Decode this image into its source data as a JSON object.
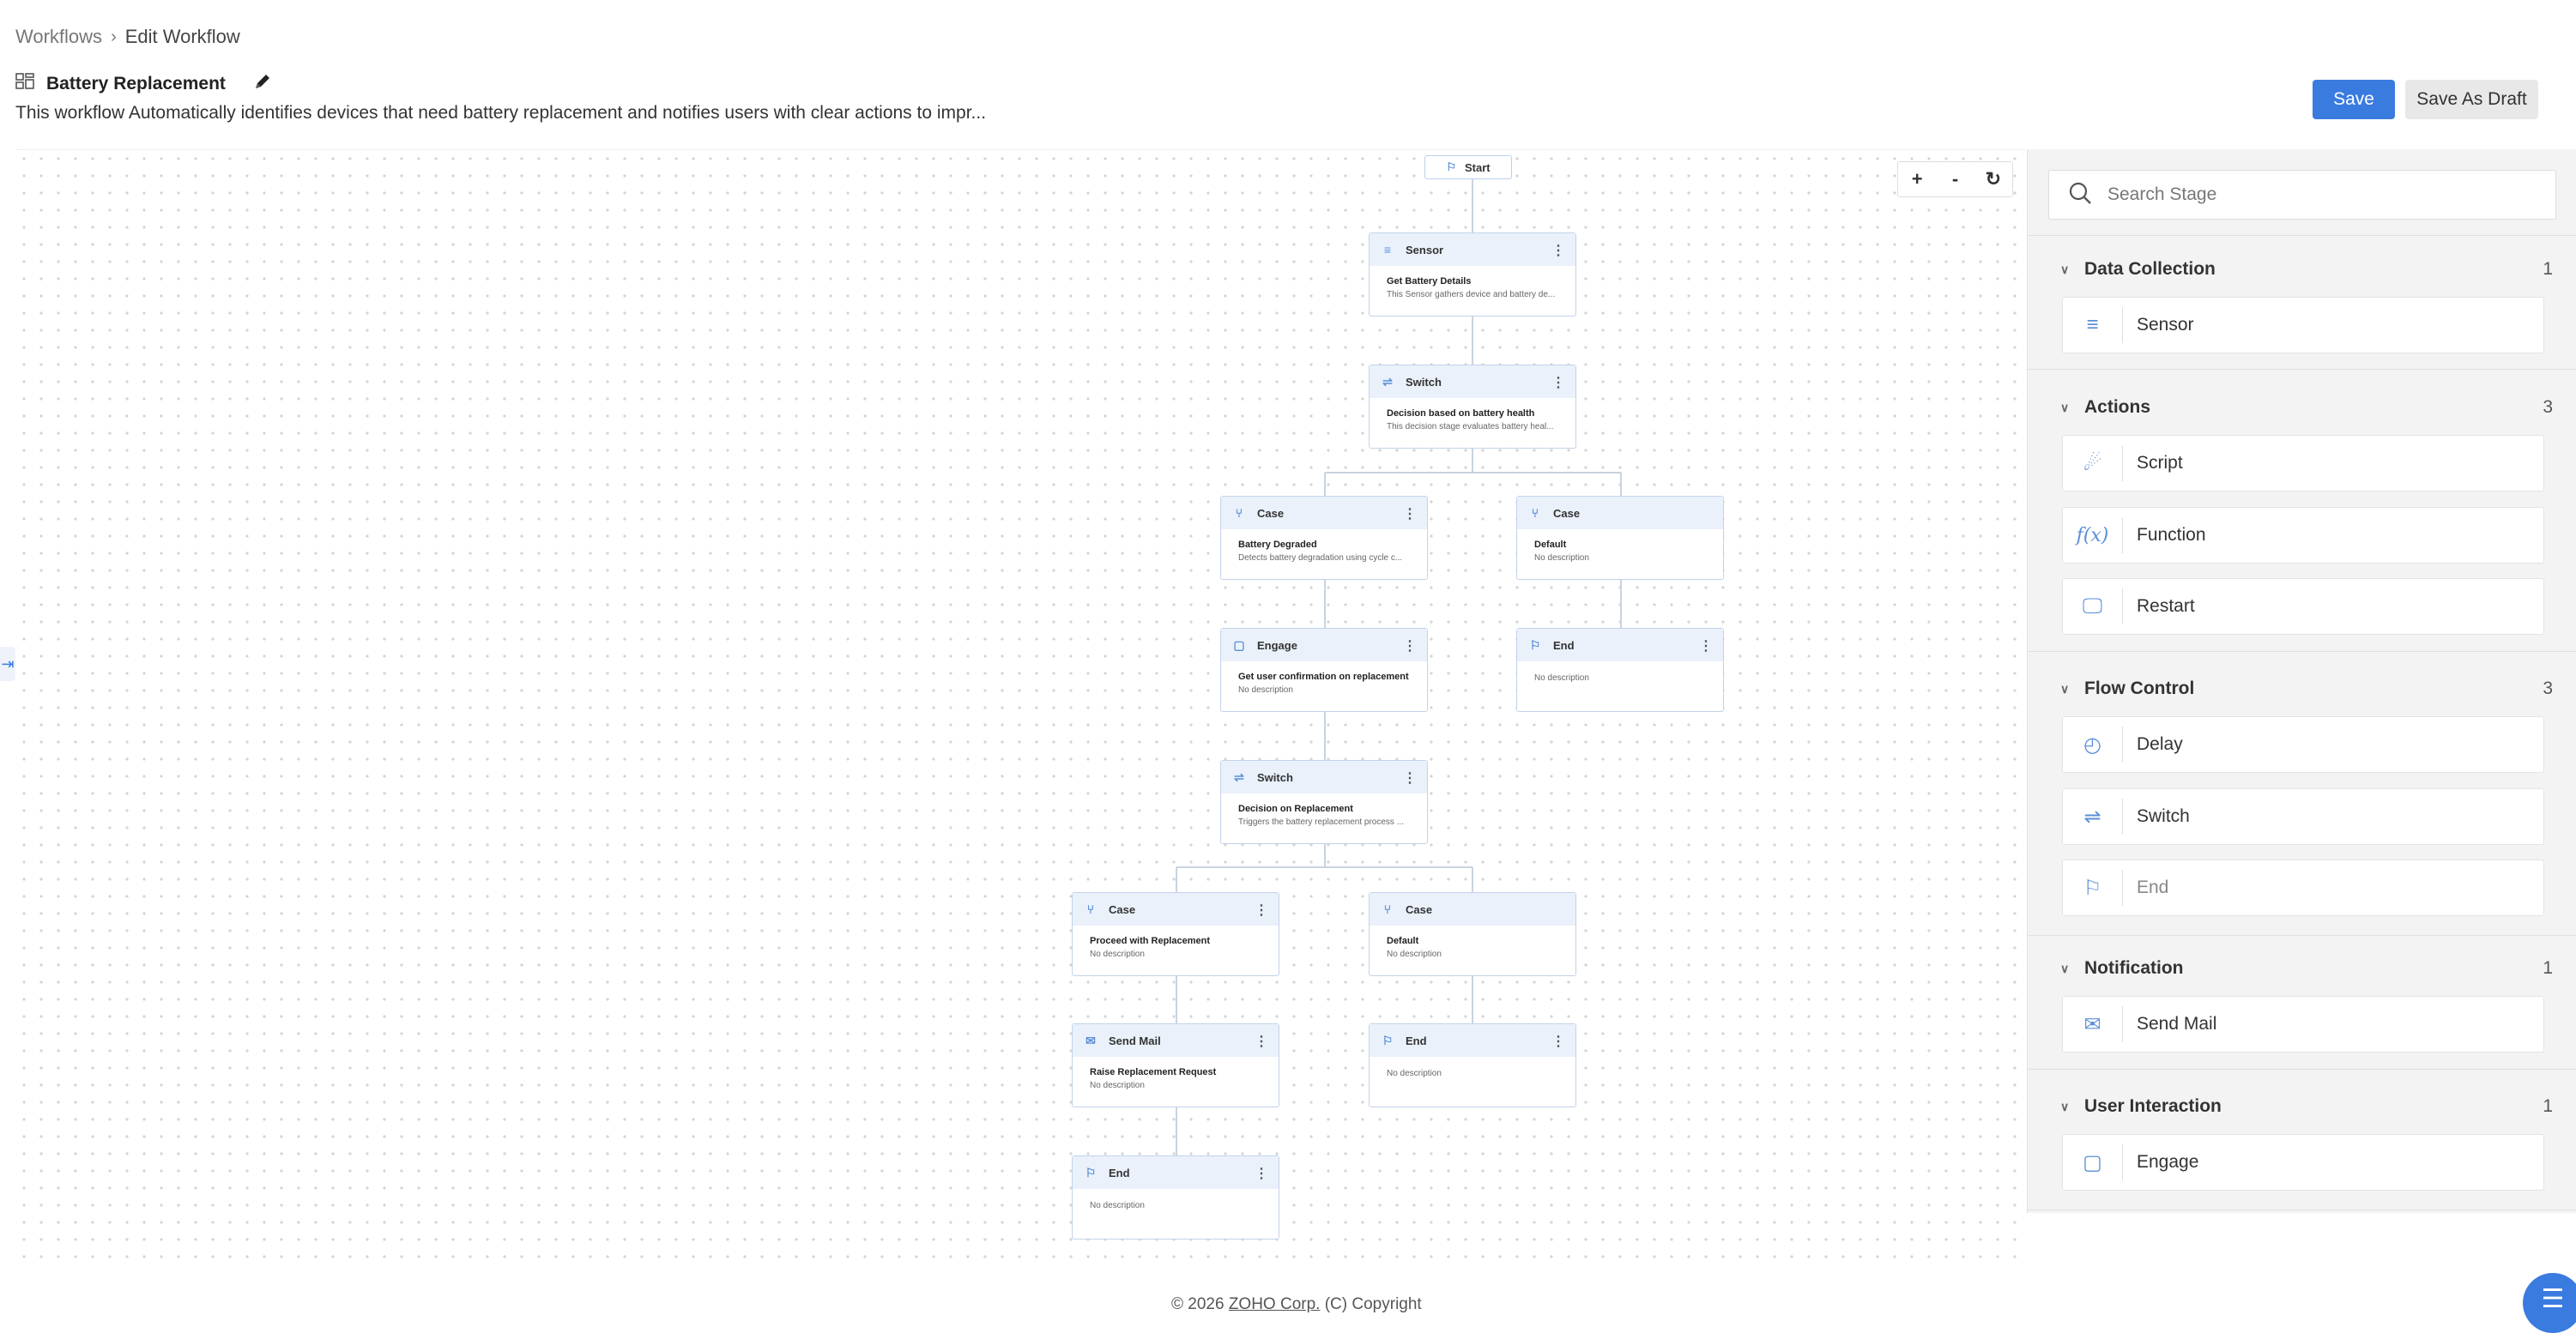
{
  "breadcrumb": {
    "root": "Workflows",
    "current": "Edit Workflow"
  },
  "workflow": {
    "title": "Battery Replacement",
    "description": "This workflow Automatically identifies devices that need battery replacement and notifies users with clear actions to impr..."
  },
  "actions": {
    "save": "Save",
    "draft": "Save As Draft"
  },
  "zoom": {
    "in": "+",
    "out": "-"
  },
  "canvas": {
    "start": "Start",
    "nodes": {
      "n1": {
        "type": "Sensor",
        "title": "Get Battery Details",
        "desc": "This Sensor gathers device and battery de..."
      },
      "n2": {
        "type": "Switch",
        "title": "Decision based on battery health",
        "desc": "This decision stage evaluates battery heal..."
      },
      "n3": {
        "type": "Case",
        "title": "Battery Degraded",
        "desc": "Detects battery degradation using cycle c..."
      },
      "n4": {
        "type": "Case",
        "title": "Default",
        "desc": "No description"
      },
      "n5": {
        "type": "Engage",
        "title": "Get user confirmation on replacement",
        "desc": "No description"
      },
      "n6": {
        "type": "End",
        "title": "",
        "desc": "No description"
      },
      "n7": {
        "type": "Switch",
        "title": "Decision on Replacement",
        "desc": "Triggers the battery replacement process ..."
      },
      "n8": {
        "type": "Case",
        "title": "Proceed with Replacement",
        "desc": "No description"
      },
      "n9": {
        "type": "Case",
        "title": "Default",
        "desc": "No description"
      },
      "n10": {
        "type": "Send Mail",
        "title": "Raise Replacement Request",
        "desc": "No description"
      },
      "n11": {
        "type": "End",
        "title": "",
        "desc": "No description"
      },
      "n12": {
        "type": "End",
        "title": "",
        "desc": "No description"
      }
    }
  },
  "panel": {
    "search_placeholder": "Search Stage",
    "sections": [
      {
        "name": "Data Collection",
        "count": "1",
        "items": [
          "Sensor"
        ]
      },
      {
        "name": "Actions",
        "count": "3",
        "items": [
          "Script",
          "Function",
          "Restart"
        ]
      },
      {
        "name": "Flow Control",
        "count": "3",
        "items": [
          "Delay",
          "Switch",
          "End"
        ]
      },
      {
        "name": "Notification",
        "count": "1",
        "items": [
          "Send Mail"
        ]
      },
      {
        "name": "User Interaction",
        "count": "1",
        "items": [
          "Engage"
        ]
      }
    ]
  },
  "footer": {
    "year": "© 2026",
    "company": "ZOHO Corp.",
    "copyright": "(C) Copyright"
  }
}
